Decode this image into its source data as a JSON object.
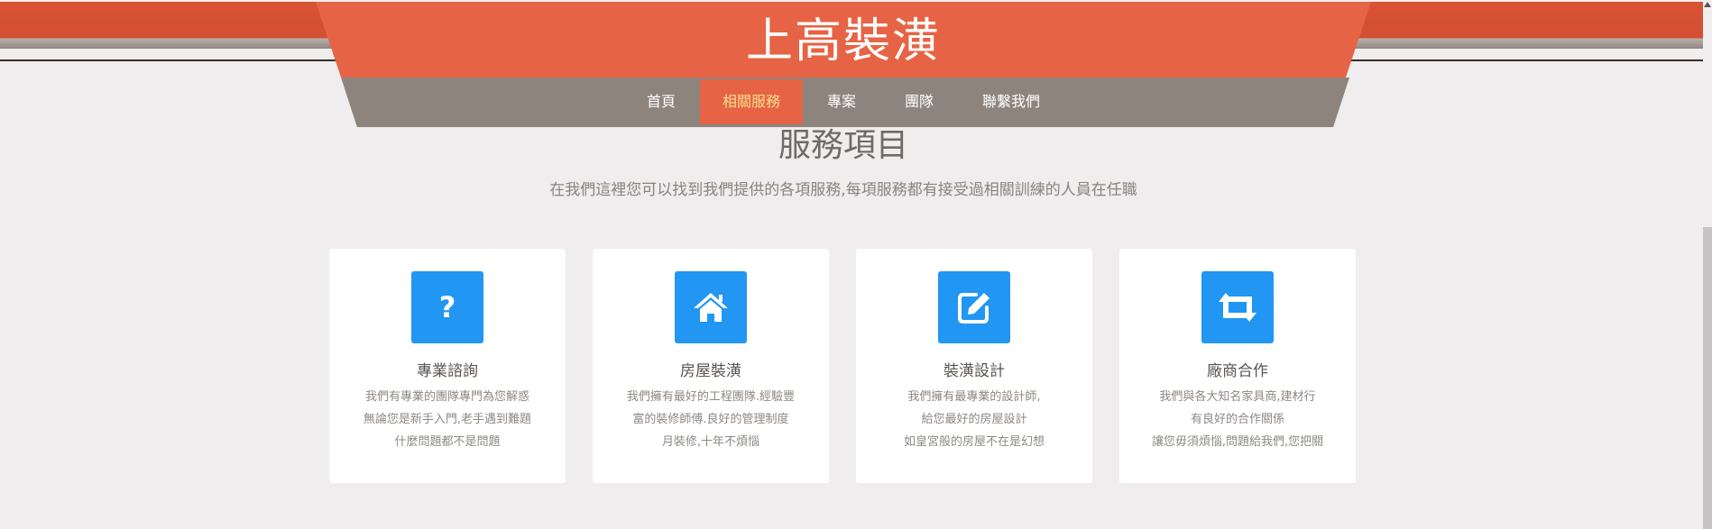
{
  "brand": "上高裝潢",
  "nav": [
    "首頁",
    "相關服務",
    "專案",
    "團隊",
    "聯繫我們"
  ],
  "section": {
    "title": "服務項目",
    "subtitle": "在我們這裡您可以找到我們提供的各項服務,每項服務都有接受過相關訓練的人員在任職"
  },
  "cards": [
    {
      "icon": "question-icon",
      "title": "專業諮詢",
      "lines": [
        "我們有專業的團隊專門為您解惑",
        "無論您是新手入門,老手遇到難題",
        "什麼問題都不是問題"
      ]
    },
    {
      "icon": "home-icon",
      "title": "房屋裝潢",
      "lines": [
        "我們擁有最好的工程團隊.經驗豐",
        "富的裝修師傅.良好的管理制度",
        "月裝修,十年不煩惱"
      ]
    },
    {
      "icon": "edit-icon",
      "title": "裝潢設計",
      "lines": [
        "我們擁有最專業的設計師,",
        "給您最好的房屋設計",
        "如皇宮般的房屋不在是幻想"
      ]
    },
    {
      "icon": "retweet-icon",
      "title": "廠商合作",
      "lines": [
        "我們與各大知名家具商,建材行",
        "有良好的合作關係",
        "讓您毋須煩惱,問題給我們,您把關"
      ]
    }
  ],
  "colors": {
    "header": "#e66445",
    "nav": "#8d847e",
    "active_text": "#f9e08d",
    "icon_bg": "#2196f3"
  }
}
